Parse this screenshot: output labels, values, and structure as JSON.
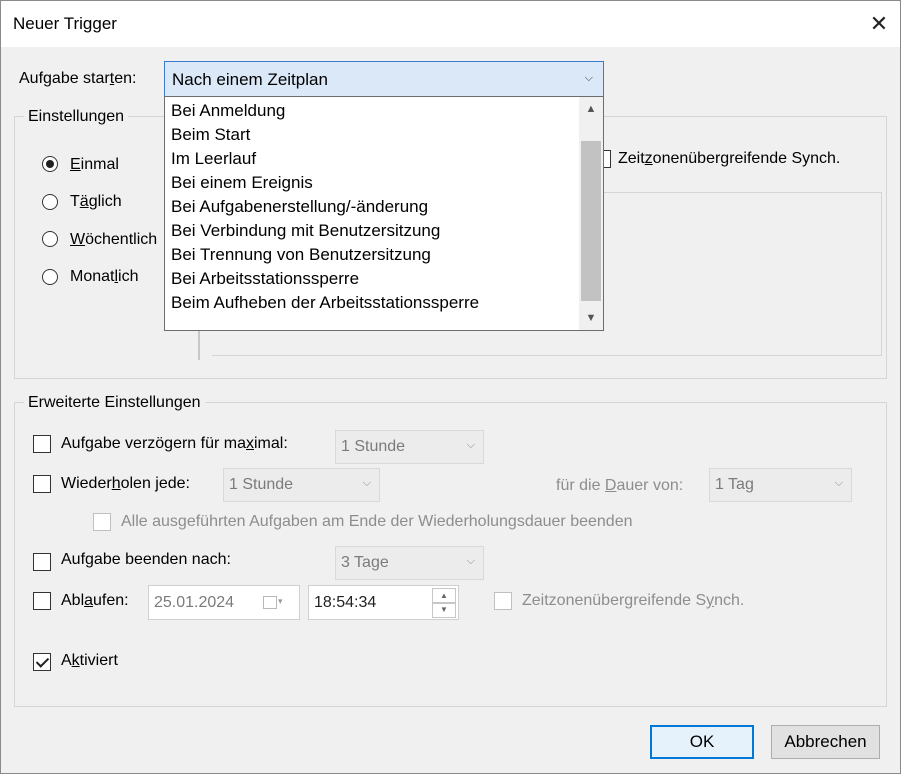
{
  "window": {
    "title": "Neuer Trigger",
    "close_glyph": "✕"
  },
  "start": {
    "label_pre": "Aufgabe star",
    "label_u": "t",
    "label_post": "en:",
    "selected": "Nach einem Zeitplan",
    "options": [
      "Bei Anmeldung",
      "Beim Start",
      "Im Leerlauf",
      "Bei einem Ereignis",
      "Bei Aufgabenerstellung/-änderung",
      "Bei Verbindung mit Benutzersitzung",
      "Bei Trennung von Benutzersitzung",
      "Bei Arbeitsstationssperre",
      "Beim Aufheben der Arbeitsstationssperre"
    ]
  },
  "settings": {
    "title": "Einstellungen",
    "radios": [
      {
        "pre": "",
        "u": "E",
        "post": "inmal",
        "checked": true
      },
      {
        "pre": "T",
        "u": "ä",
        "post": "glich",
        "checked": false
      },
      {
        "pre": "",
        "u": "W",
        "post": "öchentlich",
        "checked": false
      },
      {
        "pre": "Monat",
        "u": "l",
        "post": "ich",
        "checked": false
      }
    ],
    "tz_sync": {
      "pre": "Zeit",
      "u": "z",
      "post": "onenübergreifende Synch."
    }
  },
  "advanced": {
    "title": "Erweiterte Einstellungen",
    "delay": {
      "pre": "Aufgabe verzögern für ma",
      "u": "x",
      "post": "imal:",
      "value": "1 Stunde"
    },
    "repeat": {
      "pre": "Wieder",
      "u": "h",
      "post": "olen jede:",
      "value": "1 Stunde",
      "duration_pre": "für die ",
      "duration_u": "D",
      "duration_post": "auer von:",
      "duration_value": "1 Tag"
    },
    "stop_all": {
      "pre": "Alle ausgeführten Aufgaben am Ende der Wiederholungsdauer beenden"
    },
    "stop_after": {
      "pre": "Auf",
      "u": "g",
      "post": "abe beenden nach:",
      "value": "3 Tage"
    },
    "expire": {
      "pre": "Abl",
      "u": "a",
      "post": "ufen:",
      "date": "25.01.2024",
      "time": "18:54:34",
      "tz_pre": "Zeitzonenübergreifende S",
      "tz_u": "y",
      "tz_post": "nch."
    },
    "enabled": {
      "pre": "A",
      "u": "k",
      "post": "tiviert",
      "checked": true
    }
  },
  "buttons": {
    "ok": "OK",
    "cancel": "Abbrechen"
  }
}
